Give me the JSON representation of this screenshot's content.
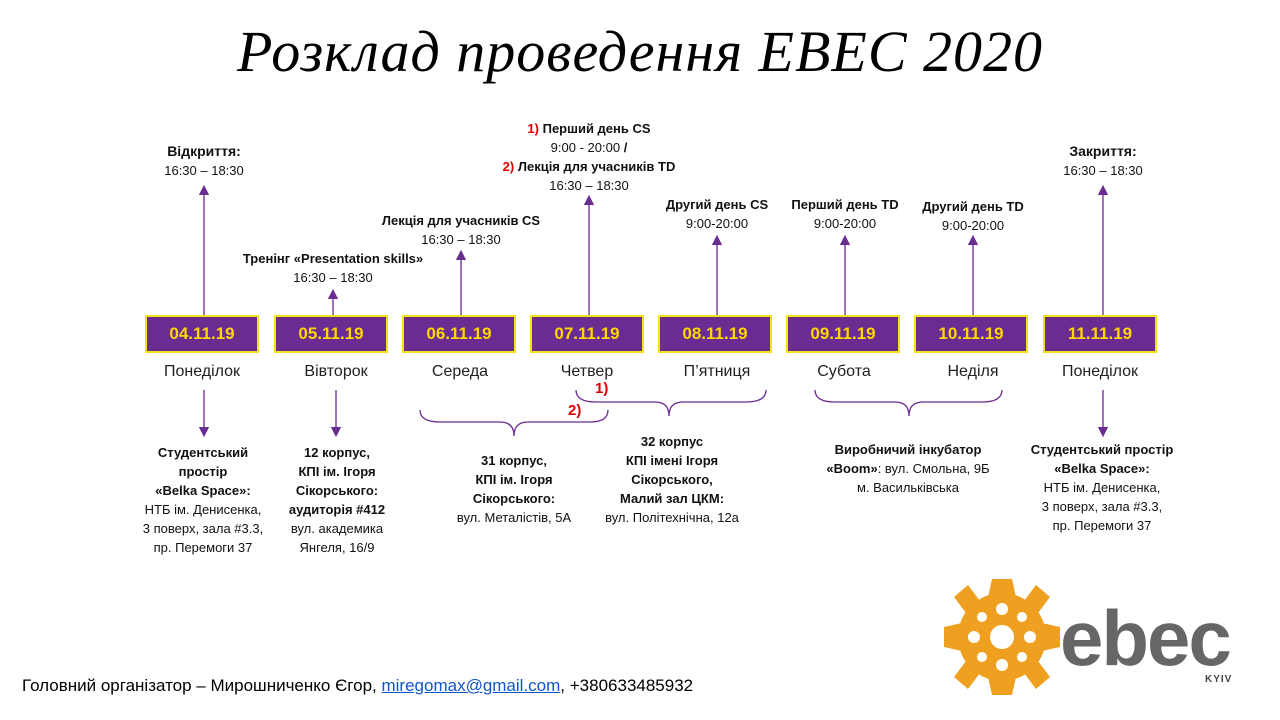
{
  "title": "Розклад проведення EBEC 2020",
  "colors": {
    "box": "#6a2c91",
    "box_border": "#f2e21a",
    "box_text": "#ffd700",
    "accent_red": "#e00000",
    "logo_orange": "#f0a020",
    "logo_gray": "#666666"
  },
  "days": [
    {
      "date": "04.11.19",
      "day": "Понеділок"
    },
    {
      "date": "05.11.19",
      "day": "Вівторок"
    },
    {
      "date": "06.11.19",
      "day": "Середа"
    },
    {
      "date": "07.11.19",
      "day": "Четвер"
    },
    {
      "date": "08.11.19",
      "day": "П’ятниця"
    },
    {
      "date": "09.11.19",
      "day": "Субота"
    },
    {
      "date": "10.11.19",
      "day": "Неділя"
    },
    {
      "date": "11.11.19",
      "day": "Понеділок"
    }
  ],
  "events": {
    "opening": {
      "title": "Відкриття:",
      "time": "16:30 – 18:30"
    },
    "training": {
      "title": "Тренінг «Presentation skills»",
      "time": "16:30 – 18:30"
    },
    "lecture_cs": {
      "title": "Лекція для учасників CS",
      "time": "16:30 – 18:30"
    },
    "thursday": {
      "m1": "1)",
      "l1": "Перший день CS",
      "t1": "9:00 - 20:00",
      "slash": "/",
      "m2": "2)",
      "l2": "Лекція для учасників TD",
      "t2": "16:30 – 18:30"
    },
    "cs_day2": {
      "title": "Другий день CS",
      "time": "9:00-20:00"
    },
    "td_day1": {
      "title": "Перший день TD",
      "time": "9:00-20:00"
    },
    "td_day2": {
      "title": "Другий день TD",
      "time": "9:00-20:00"
    },
    "closing": {
      "title": "Закриття:",
      "time": "16:30 – 18:30"
    }
  },
  "markers": {
    "m1": "1)",
    "m2": "2)"
  },
  "venues": {
    "v1": {
      "l1": "Студентський",
      "l2": "простір",
      "l3": "«Belka Space»:",
      "l4": "НТБ ім. Денисенка,",
      "l5": "3 поверх, зала #3.3,",
      "l6": "пр. Перемоги 37"
    },
    "v2": {
      "l1": "12 корпус,",
      "l2": "КПІ ім. Ігоря",
      "l3": "Сікорського:",
      "l4": "аудиторія #412",
      "l5": "вул. академика",
      "l6": "Янгеля, 16/9"
    },
    "v3": {
      "l1": "31 корпус,",
      "l2": "КПІ ім. Ігоря",
      "l3": "Сікорського:",
      "l4": "вул. Металістів, 5А"
    },
    "v4": {
      "l1": "32 корпус",
      "l2": "КПІ імені Ігоря",
      "l3": "Сікорського,",
      "l4": "Малий зал ЦКМ:",
      "l5": "вул. Політехнічна, 12а"
    },
    "v5": {
      "l1a": "Виробничий інкубатор",
      "l2a": "«Boom»",
      "l2b": ": вул. Смольна, 9Б",
      "l3": "м. Васильківська"
    },
    "v6": {
      "l1": "Студентський простір",
      "l2": "«Belka Space»:",
      "l3": "НТБ ім. Денисенка,",
      "l4": "3 поверх, зала #3.3,",
      "l5": "пр. Перемоги 37"
    }
  },
  "footer": {
    "prefix": "Головний організатор – Мирошниченко Єгор, ",
    "email": "miregomax@gmail.com",
    "phone": ", +380633485932"
  },
  "logo": {
    "name": "ebec",
    "city": "KYIV",
    "icon": "gear-logo-icon"
  }
}
